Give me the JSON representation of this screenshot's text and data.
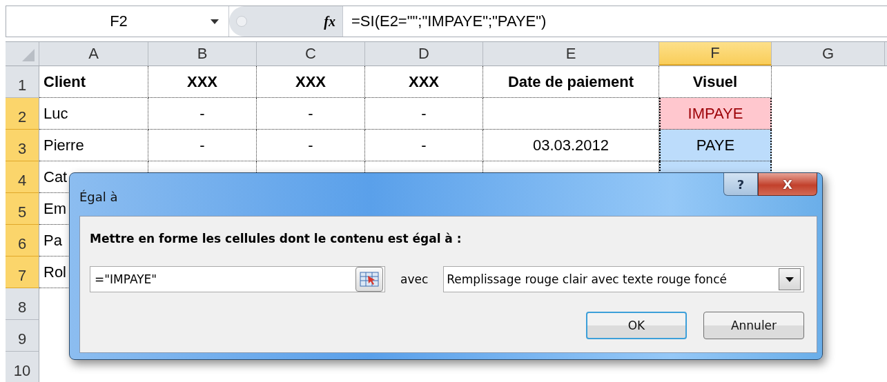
{
  "formula_bar": {
    "name_box": "F2",
    "function_label": "fx",
    "formula": "=SI(E2=\"\";\"IMPAYE\";\"PAYE\")"
  },
  "columns": [
    {
      "label": "A",
      "selected": false
    },
    {
      "label": "B",
      "selected": false
    },
    {
      "label": "C",
      "selected": false
    },
    {
      "label": "D",
      "selected": false
    },
    {
      "label": "E",
      "selected": false
    },
    {
      "label": "F",
      "selected": true
    },
    {
      "label": "G",
      "selected": false
    }
  ],
  "rows": [
    {
      "number": "1",
      "selected": false,
      "kind": "header",
      "cells": [
        {
          "text": "Client"
        },
        {
          "text": "XXX"
        },
        {
          "text": "XXX"
        },
        {
          "text": "XXX"
        },
        {
          "text": "Date de paiement"
        },
        {
          "text": "Visuel"
        },
        {}
      ]
    },
    {
      "number": "2",
      "selected": true,
      "kind": "data",
      "cells": [
        {
          "text": "Luc"
        },
        {
          "text": "-"
        },
        {
          "text": "-"
        },
        {
          "text": "-"
        },
        {},
        {
          "text": "IMPAYE",
          "color": "#ffc7ce"
        },
        {}
      ]
    },
    {
      "number": "3",
      "selected": true,
      "kind": "data",
      "cells": [
        {
          "text": "Pierre"
        },
        {
          "text": "-"
        },
        {
          "text": "-"
        },
        {
          "text": "-"
        },
        {
          "text": "03.03.2012"
        },
        {
          "text": "PAYE",
          "color": "#bcdcfb"
        },
        {}
      ]
    },
    {
      "number": "4",
      "selected": true,
      "kind": "data",
      "cells": [
        {
          "text": "Cat"
        },
        {},
        {},
        {},
        {},
        {
          "color": "#bcdcfb"
        },
        {}
      ]
    },
    {
      "number": "5",
      "selected": true,
      "kind": "data",
      "cells": [
        {
          "text": "Em"
        },
        {},
        {},
        {},
        {},
        {},
        {}
      ]
    },
    {
      "number": "6",
      "selected": true,
      "kind": "data",
      "cells": [
        {
          "text": "Pa"
        },
        {},
        {},
        {},
        {},
        {},
        {}
      ]
    },
    {
      "number": "7",
      "selected": true,
      "kind": "data",
      "cells": [
        {
          "text": "Rol"
        },
        {},
        {},
        {},
        {},
        {},
        {}
      ]
    },
    {
      "number": "8",
      "selected": false,
      "kind": "empty",
      "cells": []
    },
    {
      "number": "9",
      "selected": false,
      "kind": "empty",
      "cells": []
    },
    {
      "number": "10",
      "selected": false,
      "kind": "empty",
      "cells": []
    }
  ],
  "dialog": {
    "title": "Égal à",
    "help_button": "?",
    "close_button": "X",
    "prompt": "Mettre en forme les cellules dont le contenu est égal à :",
    "value": "=\"IMPAYE\"",
    "connector": "avec",
    "format": "Remplissage rouge clair avec texte rouge foncé",
    "buttons": [
      "OK",
      "Annuler"
    ]
  }
}
